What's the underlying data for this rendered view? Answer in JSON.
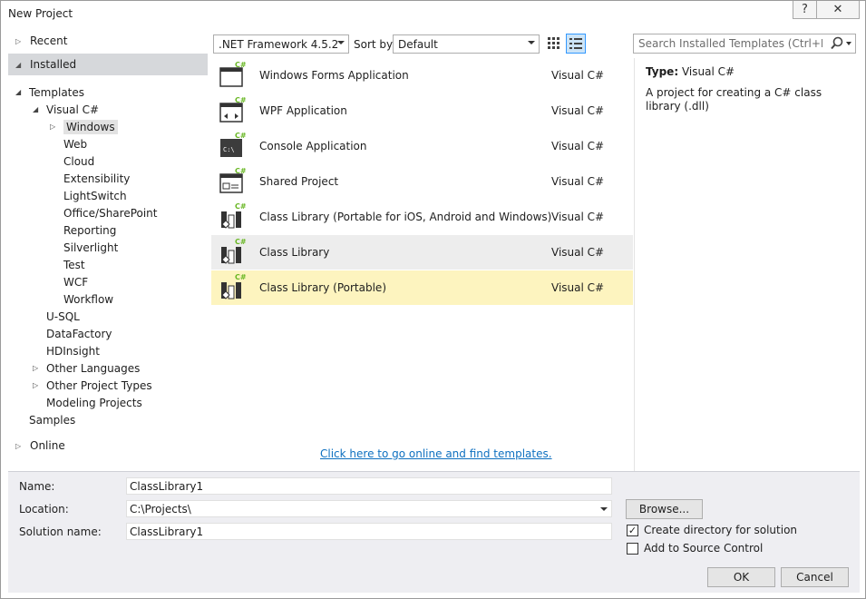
{
  "window": {
    "title": "New Project",
    "help_label": "?",
    "close_label": "✕"
  },
  "categories": {
    "recent": "Recent",
    "installed": "Installed",
    "online": "Online"
  },
  "tree": [
    {
      "label": "Templates",
      "level": 0,
      "expander": "◢"
    },
    {
      "label": "Visual C#",
      "level": 1,
      "expander": "◢"
    },
    {
      "label": "Windows",
      "level": 2,
      "expander": "▷",
      "selected": true
    },
    {
      "label": "Web",
      "level": 2
    },
    {
      "label": "Cloud",
      "level": 2
    },
    {
      "label": "Extensibility",
      "level": 2
    },
    {
      "label": "LightSwitch",
      "level": 2
    },
    {
      "label": "Office/SharePoint",
      "level": 2
    },
    {
      "label": "Reporting",
      "level": 2
    },
    {
      "label": "Silverlight",
      "level": 2
    },
    {
      "label": "Test",
      "level": 2
    },
    {
      "label": "WCF",
      "level": 2
    },
    {
      "label": "Workflow",
      "level": 2
    },
    {
      "label": "U-SQL",
      "level": 1
    },
    {
      "label": "DataFactory",
      "level": 1
    },
    {
      "label": "HDInsight",
      "level": 1
    },
    {
      "label": "Other Languages",
      "level": 1,
      "expander": "▷"
    },
    {
      "label": "Other Project Types",
      "level": 1,
      "expander": "▷"
    },
    {
      "label": "Modeling Projects",
      "level": 1
    },
    {
      "label": "Samples",
      "level": 0
    }
  ],
  "toolbar": {
    "framework": ".NET Framework 4.5.2",
    "sort_label": "Sort by:",
    "sort_value": "Default",
    "search_placeholder": "Search Installed Templates (Ctrl+E)"
  },
  "templates": [
    {
      "name": "Windows Forms Application",
      "lang": "Visual C#",
      "icon": "winforms-icon"
    },
    {
      "name": "WPF Application",
      "lang": "Visual C#",
      "icon": "wpf-icon"
    },
    {
      "name": "Console Application",
      "lang": "Visual C#",
      "icon": "console-icon"
    },
    {
      "name": "Shared Project",
      "lang": "Visual C#",
      "icon": "shared-project-icon"
    },
    {
      "name": "Class Library (Portable for iOS, Android and Windows)",
      "lang": "Visual C#",
      "icon": "class-library-icon"
    },
    {
      "name": "Class Library",
      "lang": "Visual C#",
      "icon": "class-library-icon",
      "state": "hover"
    },
    {
      "name": "Class Library (Portable)",
      "lang": "Visual C#",
      "icon": "class-library-icon",
      "state": "selected"
    }
  ],
  "icon_badge": "C#",
  "console_glyph": "C:\\",
  "online_link": "Click here to go online and find templates.",
  "details": {
    "type_label": "Type:",
    "type_value": "Visual C#",
    "description": "A project for creating a C# class library (.dll)"
  },
  "form": {
    "name_label": "Name:",
    "name_value": "ClassLibrary1",
    "location_label": "Location:",
    "location_value": "C:\\Projects\\",
    "solution_label": "Solution name:",
    "solution_value": "ClassLibrary1",
    "browse_label": "Browse...",
    "create_dir_label": "Create directory for solution",
    "create_dir_checked": true,
    "source_control_label": "Add to Source Control",
    "source_control_checked": false,
    "ok_label": "OK",
    "cancel_label": "Cancel"
  },
  "colors": {
    "accent": "#3399ff",
    "selected_row": "#fdf4bf",
    "hover_row": "#ededed",
    "link": "#0e70c0",
    "csharp_green": "#68b723"
  }
}
